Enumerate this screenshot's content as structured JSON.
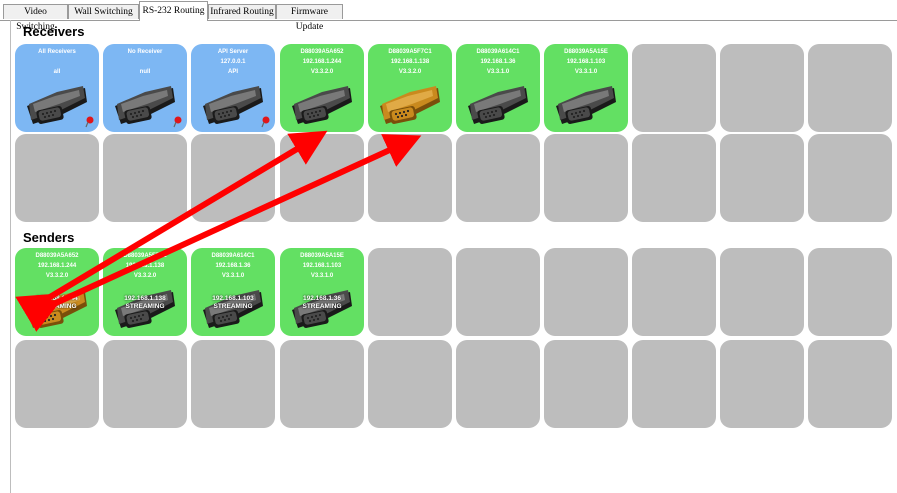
{
  "tabs": [
    {
      "label": "Video Switching",
      "active": false
    },
    {
      "label": "Wall Switching",
      "active": false
    },
    {
      "label": "RS-232 Routing",
      "active": true
    },
    {
      "label": "Infrared Routing",
      "active": false
    },
    {
      "label": "Firmware Update",
      "active": false
    }
  ],
  "receivers": {
    "title": "Receivers",
    "tiles": [
      {
        "color": "blue",
        "name": "All Receivers",
        "line2": "",
        "line3": "all",
        "connector": "gray",
        "pin": true
      },
      {
        "color": "blue",
        "name": "No Receiver",
        "line2": "",
        "line3": "null",
        "connector": "gray",
        "pin": true
      },
      {
        "color": "blue",
        "name": "API Server",
        "line2": "127.0.0.1",
        "line3": "API",
        "connector": "gray",
        "pin": true
      },
      {
        "color": "green",
        "name": "D88039A5A652",
        "line2": "192.168.1.244",
        "line3": "V3.3.2.0",
        "connector": "gray",
        "pin": false
      },
      {
        "color": "green",
        "name": "D88039A5F7C1",
        "line2": "192.168.1.138",
        "line3": "V3.3.2.0",
        "connector": "gold",
        "pin": false
      },
      {
        "color": "green",
        "name": "D88039A614C1",
        "line2": "192.168.1.36",
        "line3": "V3.3.1.0",
        "connector": "gray",
        "pin": false
      },
      {
        "color": "green",
        "name": "D88039A5A15E",
        "line2": "192.168.1.103",
        "line3": "V3.3.1.0",
        "connector": "gray",
        "pin": false
      }
    ]
  },
  "senders": {
    "title": "Senders",
    "tiles": [
      {
        "color": "green",
        "name": "D88039A5A652",
        "line2": "192.168.1.244",
        "line3": "V3.3.2.0",
        "connector": "gold",
        "overlay1": "192.168.1.244",
        "overlay2": "STREAMING"
      },
      {
        "color": "green",
        "name": "D88039A5F7C1",
        "line2": "192.168.1.138",
        "line3": "V3.3.2.0",
        "connector": "gray",
        "overlay1": "192.168.1.138",
        "overlay2": "STREAMING"
      },
      {
        "color": "green",
        "name": "D88039A614C1",
        "line2": "192.168.1.36",
        "line3": "V3.3.1.0",
        "connector": "gray",
        "overlay1": "192.168.1.103",
        "overlay2": "STREAMING"
      },
      {
        "color": "green",
        "name": "D88039A5A15E",
        "line2": "192.168.1.103",
        "line3": "V3.3.1.0",
        "connector": "gray",
        "overlay1": "192.168.1.36",
        "overlay2": "STREAMING"
      }
    ]
  },
  "colors": {
    "blue_tile": "#7db7f3",
    "green_tile": "#63e063",
    "empty_tile": "#bdbdbd",
    "arrow": "#ff0000"
  }
}
